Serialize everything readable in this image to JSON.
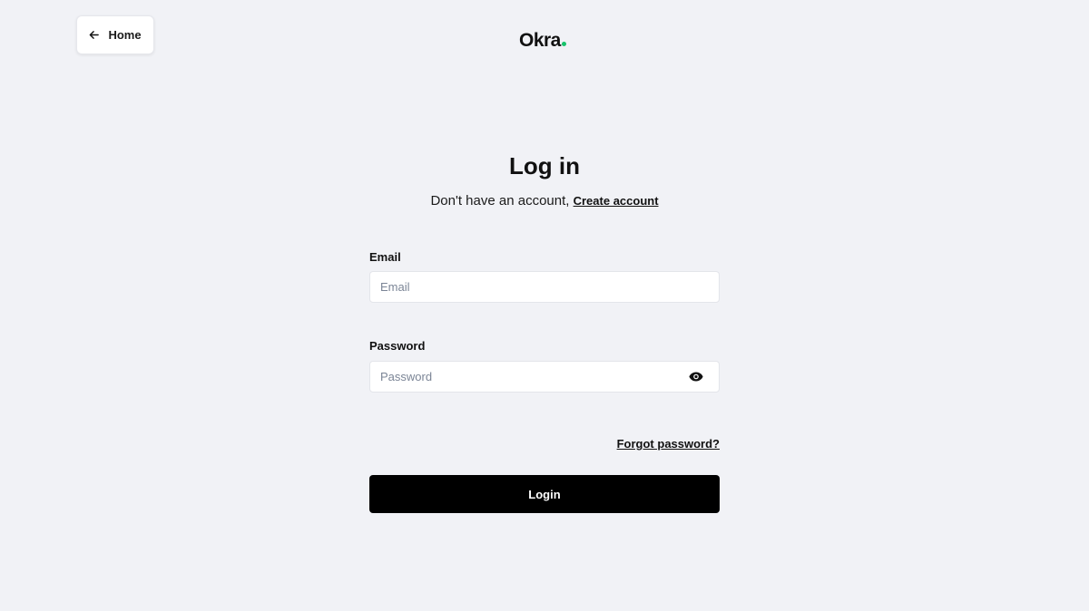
{
  "header": {
    "home_label": "Home",
    "logo_text": "Okra",
    "logo_dot_color": "#16c26a"
  },
  "main": {
    "title": "Log in",
    "subtitle_text": "Don't have an account, ",
    "create_account_link": "Create account"
  },
  "form": {
    "email_label": "Email",
    "email_placeholder": "Email",
    "email_value": "",
    "password_label": "Password",
    "password_placeholder": "Password",
    "password_value": "",
    "password_visibility_icon": "eye-icon",
    "forgot_password_link": "Forgot password?",
    "login_button": "Login"
  }
}
